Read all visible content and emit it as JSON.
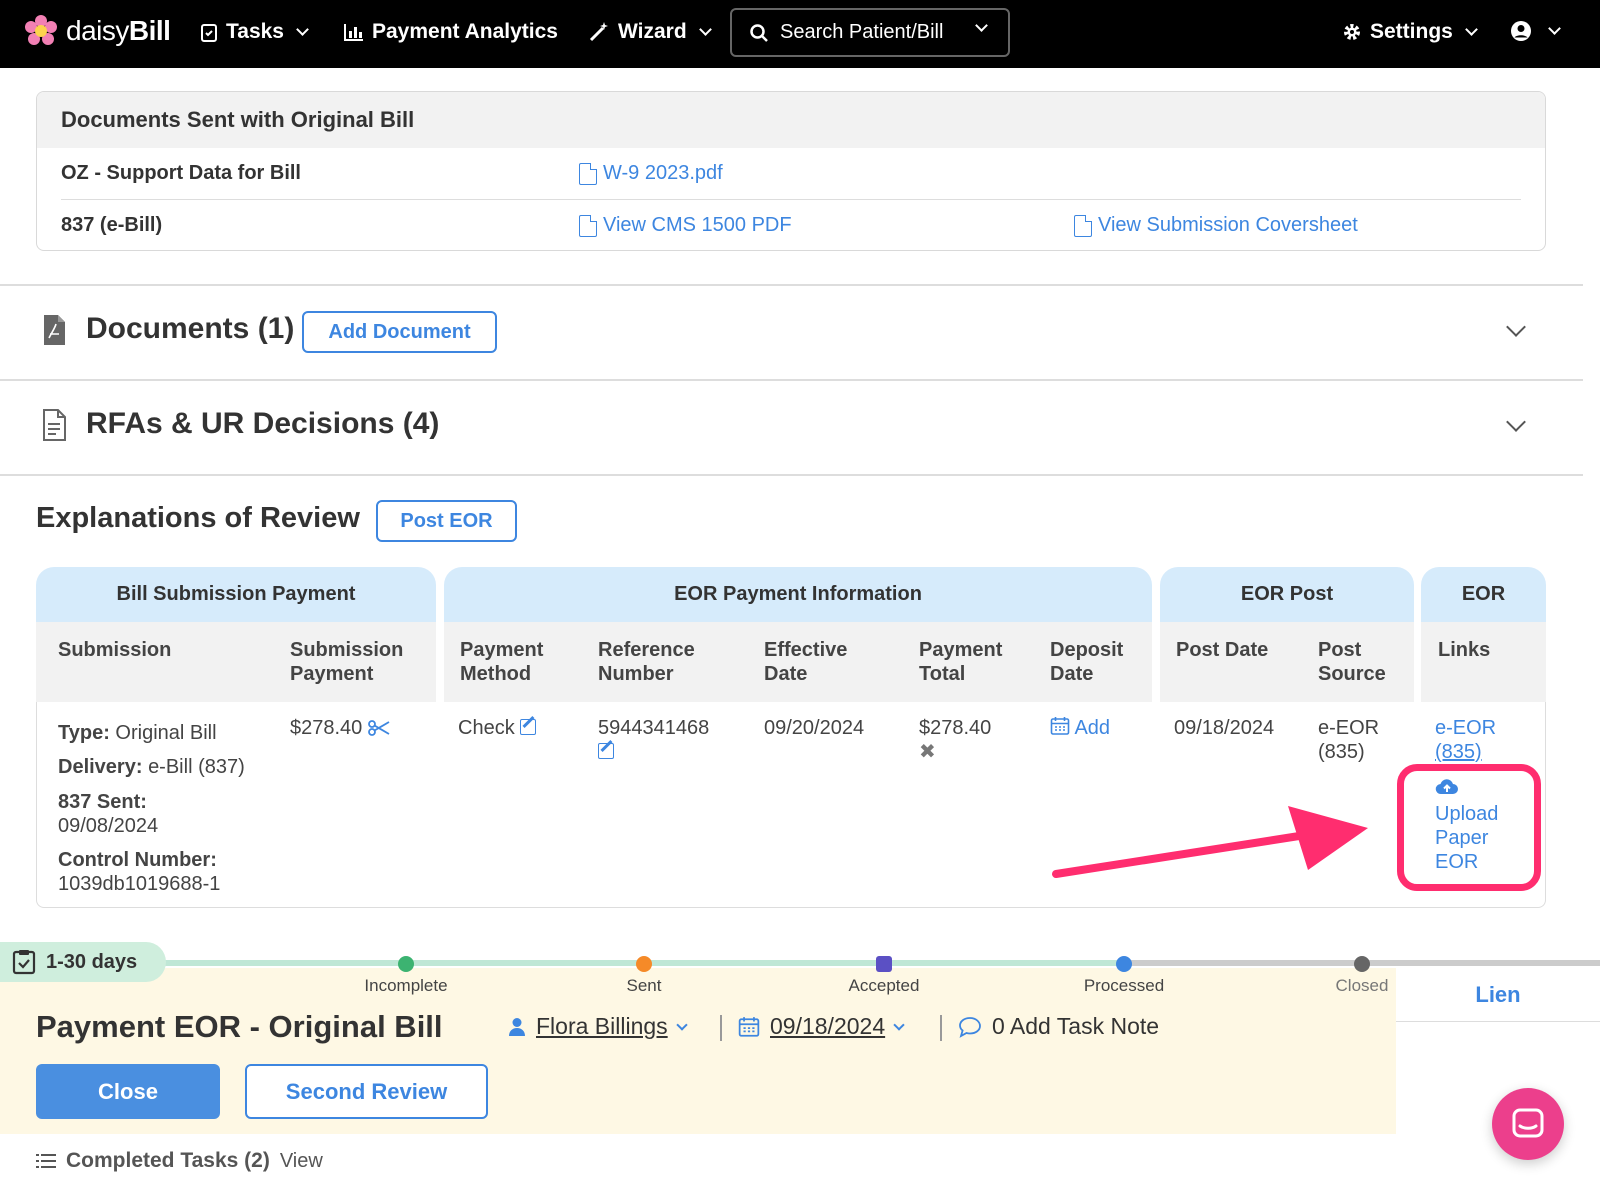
{
  "nav": {
    "brand_light": "daisy",
    "brand_bold": "Bill",
    "tasks": "Tasks",
    "payment_analytics": "Payment Analytics",
    "wizard": "Wizard",
    "search_placeholder": "Search Patient/Bill",
    "settings": "Settings"
  },
  "sent_docs": {
    "title": "Documents Sent with Original Bill",
    "rows": [
      {
        "label": "OZ - Support Data for Bill",
        "link1": "W-9 2023.pdf"
      },
      {
        "label": "837 (e-Bill)",
        "link1": "View CMS 1500 PDF",
        "link2": "View Submission Coversheet"
      }
    ]
  },
  "documents": {
    "title": "Documents (1)",
    "add_button": "Add Document"
  },
  "rfas": {
    "title": "RFAs & UR Decisions (4)"
  },
  "eor": {
    "title": "Explanations of Review",
    "post_button": "Post EOR",
    "groups": [
      "Bill Submission Payment",
      "EOR Payment Information",
      "EOR Post",
      "EOR"
    ],
    "columns": {
      "submission": "Submission",
      "submission_payment_1": "Submission",
      "submission_payment_2": "Payment",
      "payment_method_1": "Payment",
      "payment_method_2": "Method",
      "reference_1": "Reference",
      "reference_2": "Number",
      "effective_1": "Effective",
      "effective_2": "Date",
      "payment_total_1": "Payment",
      "payment_total_2": "Total",
      "deposit_1": "Deposit",
      "deposit_2": "Date",
      "post_date": "Post Date",
      "post_source_1": "Post",
      "post_source_2": "Source",
      "links": "Links"
    },
    "row": {
      "type_label": "Type:",
      "type_value": "Original Bill",
      "delivery_label": "Delivery:",
      "delivery_value": "e-Bill (837)",
      "sent_label": "837 Sent:",
      "sent_value": "09/08/2024",
      "control_label": "Control Number:",
      "control_value": "1039db1019688-1",
      "submission_payment": "$278.40",
      "payment_method": "Check",
      "reference_number": "5944341468",
      "effective_date": "09/20/2024",
      "payment_total": "$278.40",
      "deposit_add": "Add",
      "post_date": "09/18/2024",
      "post_source_1": "e-EOR",
      "post_source_2": "(835)",
      "eeor_link_1": "e-EOR",
      "eeor_link_2": "(835)",
      "upload_1": "Upload",
      "upload_2": "Paper",
      "upload_3": "EOR"
    }
  },
  "task": {
    "days": "1-30 days",
    "stages": [
      "Incomplete",
      "Sent",
      "Accepted",
      "Processed",
      "Closed"
    ],
    "lien": "Lien",
    "title": "Payment EOR - Original Bill",
    "assignee": "Flora Billings",
    "date": "09/18/2024",
    "note": "0 Add Task Note",
    "close_button": "Close",
    "second_review_button": "Second Review",
    "completed_label": "Completed Tasks (2)",
    "completed_view": "View"
  },
  "colors": {
    "accent": "#3d86e0",
    "highlight": "#ff2d6f",
    "brand_pink": "#ec3f8c"
  }
}
